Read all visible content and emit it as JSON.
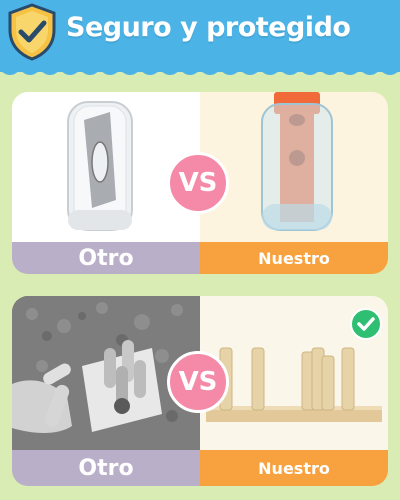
{
  "header": {
    "title": "Seguro y protegido",
    "background": "#4bb3e6",
    "icon": "shield-check-icon"
  },
  "comparisons": [
    {
      "left_label": "Otro",
      "right_label": "Nuestro",
      "vs_label": "VS"
    },
    {
      "left_label": "Otro",
      "right_label": "Nuestro",
      "vs_label": "VS"
    }
  ],
  "badge": {
    "icon": "check-icon",
    "color": "#2fbf73"
  },
  "colors": {
    "page_background": "#d9ecb4",
    "label_other": "#b9afc8",
    "label_ours": "#f7a23e",
    "vs_circle": "#f58aa8"
  }
}
